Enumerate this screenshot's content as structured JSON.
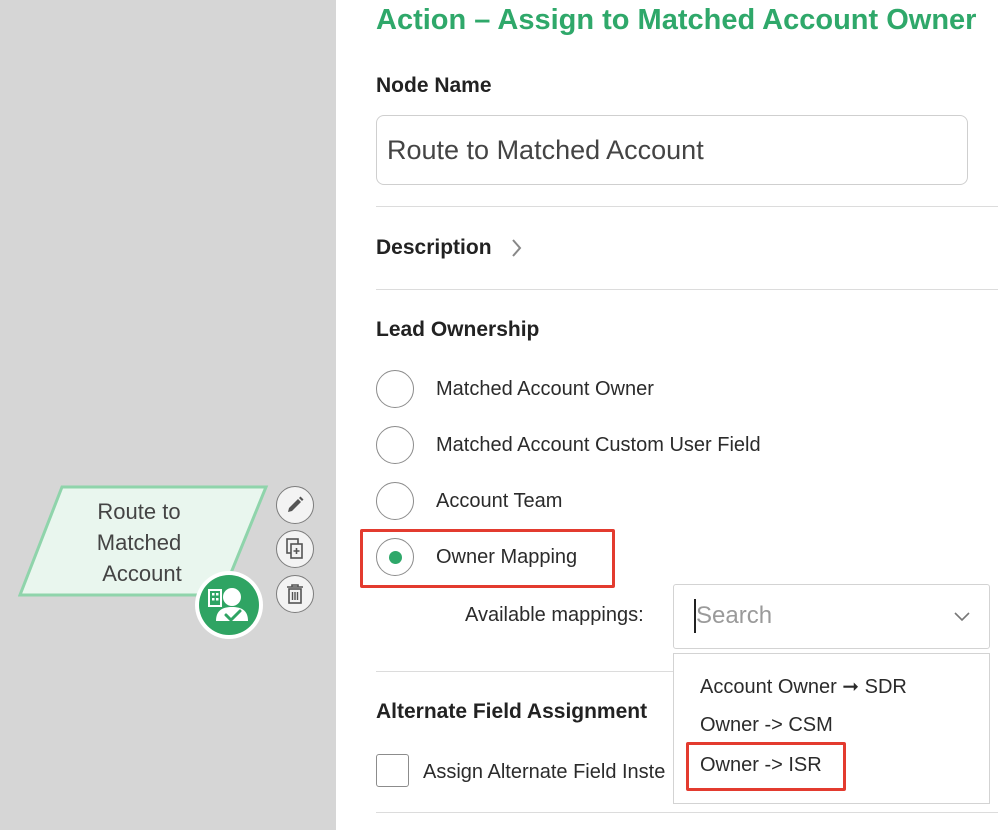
{
  "canvas": {
    "node": {
      "label_lines": [
        "Route to",
        "Matched",
        "Account"
      ],
      "badge_icon": "account-owner-icon",
      "color": "#2fa463"
    },
    "tools": [
      {
        "name": "edit",
        "icon": "pencil-icon"
      },
      {
        "name": "duplicate",
        "icon": "duplicate-icon"
      },
      {
        "name": "delete",
        "icon": "trash-icon"
      }
    ]
  },
  "panel": {
    "title": "Action – Assign to Matched Account Owner",
    "node_name": {
      "label": "Node Name",
      "value": "Route to Matched Account"
    },
    "description": {
      "label": "Description"
    },
    "lead_ownership": {
      "label": "Lead Ownership",
      "options": [
        {
          "label": "Matched Account Owner",
          "selected": false
        },
        {
          "label": "Matched Account Custom User Field",
          "selected": false
        },
        {
          "label": "Account Team",
          "selected": false
        },
        {
          "label": "Owner Mapping",
          "selected": true
        }
      ],
      "available_mappings": {
        "label": "Available mappings:",
        "placeholder": "Search",
        "options": [
          "Account Owner ➞ SDR",
          "Owner -> CSM",
          "Owner -> ISR"
        ]
      }
    },
    "alternate": {
      "label": "Alternate Field Assignment",
      "checkbox_label": "Assign Alternate Field Inste",
      "checked": false
    }
  },
  "colors": {
    "accent": "#2fa86a",
    "highlight": "#e33b2f",
    "canvas_bg": "#d6d6d6"
  }
}
